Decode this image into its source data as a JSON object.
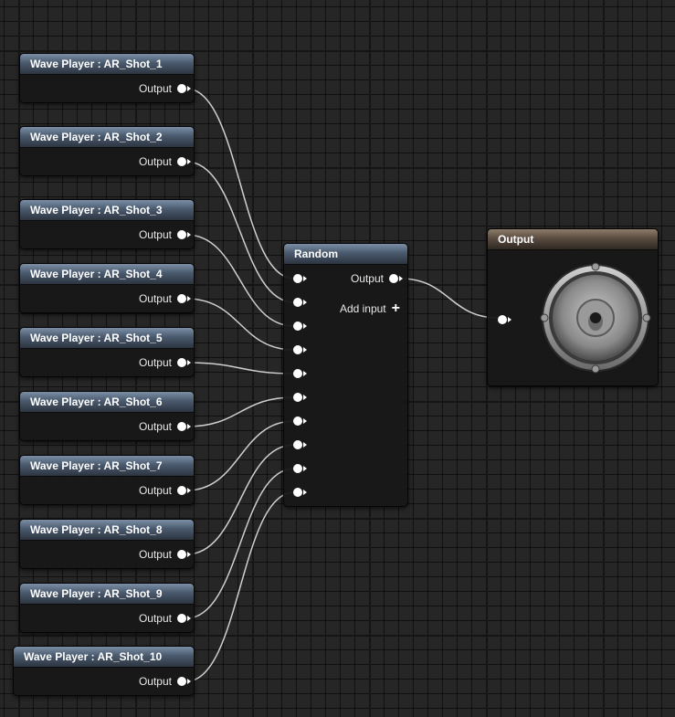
{
  "wave_players": [
    {
      "title": "Wave Player : AR_Shot_1",
      "output_label": "Output"
    },
    {
      "title": "Wave Player : AR_Shot_2",
      "output_label": "Output"
    },
    {
      "title": "Wave Player : AR_Shot_3",
      "output_label": "Output"
    },
    {
      "title": "Wave Player : AR_Shot_4",
      "output_label": "Output"
    },
    {
      "title": "Wave Player : AR_Shot_5",
      "output_label": "Output"
    },
    {
      "title": "Wave Player : AR_Shot_6",
      "output_label": "Output"
    },
    {
      "title": "Wave Player : AR_Shot_7",
      "output_label": "Output"
    },
    {
      "title": "Wave Player : AR_Shot_8",
      "output_label": "Output"
    },
    {
      "title": "Wave Player : AR_Shot_9",
      "output_label": "Output"
    },
    {
      "title": "Wave Player : AR_Shot_10",
      "output_label": "Output"
    }
  ],
  "random_node": {
    "title": "Random",
    "output_label": "Output",
    "add_input_label": "Add input"
  },
  "output_node": {
    "title": "Output",
    "icon": "speaker-icon"
  },
  "colors": {
    "wire": "#cfcfcf",
    "node_header_sound": "#4a5a6e",
    "node_header_output": "#5a4c40",
    "grid_background": "#262626"
  }
}
